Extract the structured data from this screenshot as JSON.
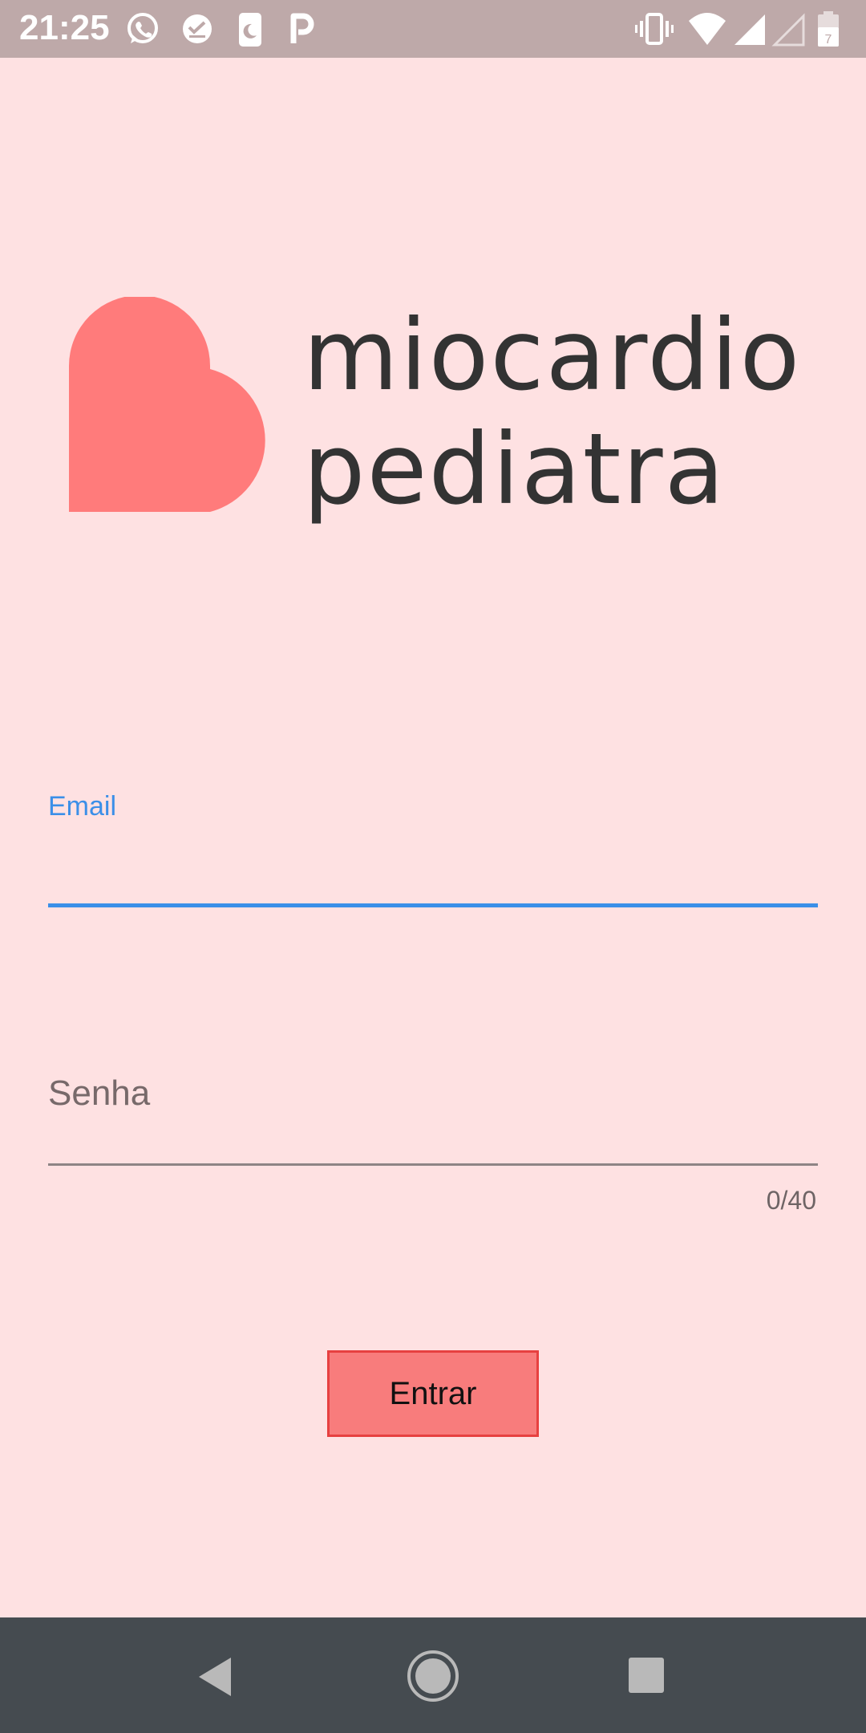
{
  "status_bar": {
    "time": "21:25",
    "notification_icons": [
      "whatsapp-icon",
      "checkmark-icon",
      "phone-moon-icon",
      "p-icon"
    ],
    "system_icons": [
      "vibrate-icon",
      "wifi-icon",
      "signal-icon",
      "signal-empty-icon",
      "battery-icon"
    ],
    "battery_level": "7"
  },
  "logo": {
    "line1": "miocardio",
    "line2": "pediatra",
    "heart_color": "#FF7B7B",
    "text_color": "#333333"
  },
  "form": {
    "email": {
      "label": "Email",
      "value": "",
      "accent_color": "#3A8FE8"
    },
    "password": {
      "placeholder": "Senha",
      "value": "",
      "counter": "0/40"
    },
    "submit_label": "Entrar"
  },
  "colors": {
    "background": "#FEE1E2",
    "button": "#F87C7C",
    "button_border": "#E74040",
    "nav_bar": "#454B50"
  },
  "nav": {
    "icons": [
      "back-icon",
      "home-icon",
      "recent-apps-icon"
    ]
  }
}
